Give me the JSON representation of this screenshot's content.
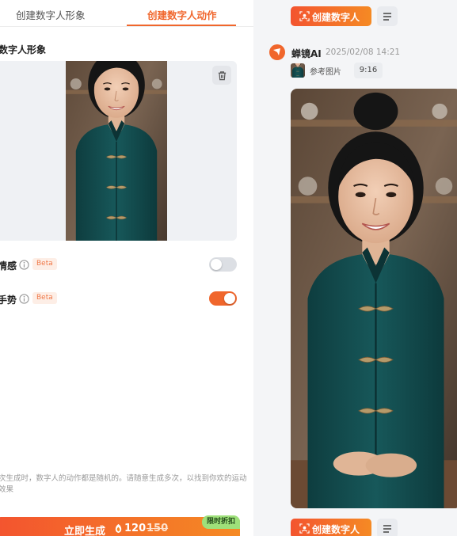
{
  "tabs": [
    {
      "label": "创建数字人形象"
    },
    {
      "label": "创建数字人动作"
    }
  ],
  "form": {
    "section_title": "数字人形象",
    "emotion": {
      "label": "情感",
      "badge": "Beta",
      "enabled": false
    },
    "gesture": {
      "label": "手势",
      "badge": "Beta",
      "enabled": true
    },
    "hint": "次生成时，数字人的动作都是随机的。请随意生成多次，以找到你欢的运动效果"
  },
  "generate": {
    "label": "立即生成",
    "price": "120",
    "original_price": "150",
    "promo_badge": "限时折扣"
  },
  "chat": {
    "create_button_label": "创建数字人",
    "bot_name": "蝉镜AI",
    "timestamp": "2025/02/08 14:21",
    "reference_label": "参考图片",
    "duration": "9:16"
  },
  "icons": {
    "trash": "trash-icon",
    "info": "info-icon",
    "coin": "coin-icon",
    "menu": "menu-icon",
    "create": "create-person-icon",
    "bot": "bot-avatar-icon"
  },
  "colors": {
    "accent": "#f0662c",
    "accent_gradient_end": "#f58a24",
    "promo_green": "#9ee07a",
    "switch_off": "#dcdfe4",
    "beta_bg": "#fdeee6"
  }
}
